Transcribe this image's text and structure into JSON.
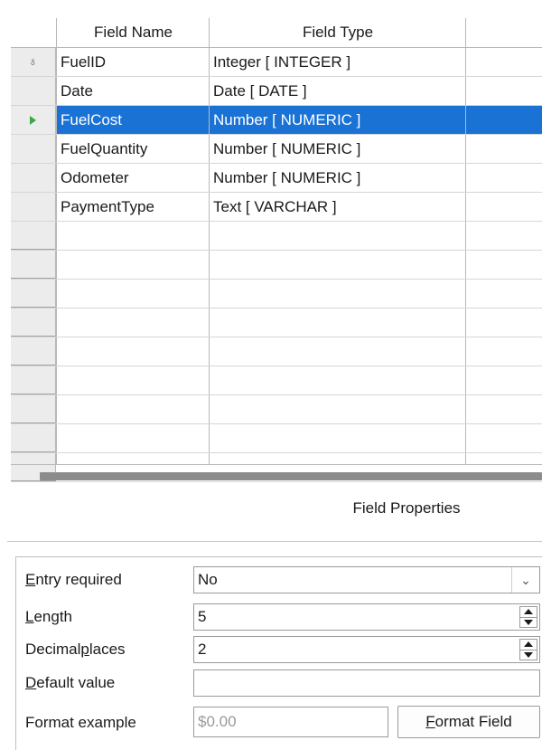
{
  "grid": {
    "columns": [
      "Field Name",
      "Field Type"
    ],
    "rows": [
      {
        "name": "FuelID",
        "type": "Integer [ INTEGER ]",
        "marker": "key-icon"
      },
      {
        "name": "Date",
        "type": "Date [ DATE ]",
        "marker": ""
      },
      {
        "name": "FuelCost",
        "type": "Number [ NUMERIC ]",
        "marker": "current-row-arrow-icon",
        "selected": true
      },
      {
        "name": "FuelQuantity",
        "type": "Number [ NUMERIC ]",
        "marker": ""
      },
      {
        "name": "Odometer",
        "type": "Number [ NUMERIC ]",
        "marker": ""
      },
      {
        "name": "PaymentType",
        "type": "Text [ VARCHAR ]",
        "marker": ""
      }
    ],
    "selection_color": "#1a73d4"
  },
  "properties": {
    "title": "Field Properties",
    "entry_required": {
      "label": "Entry required",
      "accel": "E",
      "rest": "ntry required",
      "value": "No"
    },
    "length": {
      "label": "Length",
      "accel": "L",
      "rest": "ength",
      "value": "5"
    },
    "decimal_places": {
      "label": "Decimal places",
      "pre": "Decimal ",
      "accel": "p",
      "rest": "laces",
      "value": "2"
    },
    "default_value": {
      "label": "Default value",
      "accel": "D",
      "rest": "efault value",
      "value": ""
    },
    "format_example": {
      "label": "Format example",
      "value": "$0.00"
    },
    "format_button": {
      "label": "Format Field",
      "accel": "F",
      "rest": "ormat Field"
    }
  }
}
